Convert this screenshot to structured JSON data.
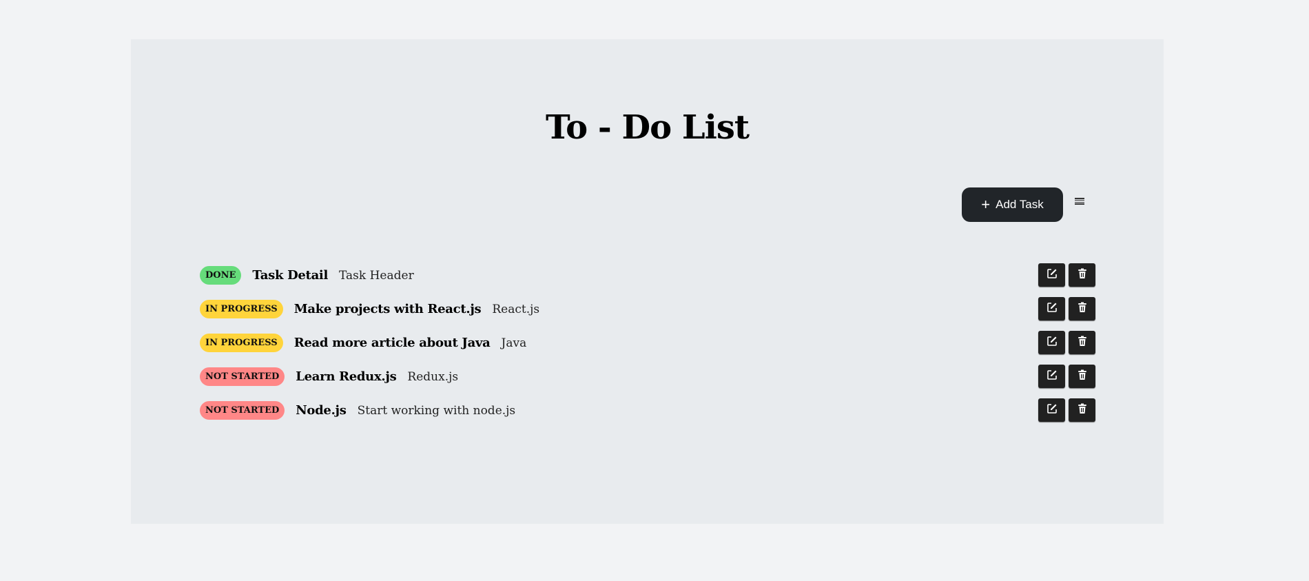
{
  "header": {
    "title": "To - Do List"
  },
  "toolbar": {
    "add_label": "Add Task",
    "add_icon": "plus-icon",
    "menu_icon": "list-icon"
  },
  "colors": {
    "done": "#66dc7b",
    "in_progress": "#ffd43b",
    "not_started": "#ff8787",
    "button": "#212529"
  },
  "tasks": [
    {
      "status": "DONE",
      "title": "Task Detail",
      "description": "Task Header"
    },
    {
      "status": "IN PROGRESS",
      "title": "Make projects with React.js",
      "description": "React.js"
    },
    {
      "status": "IN PROGRESS",
      "title": "Read more article about Java",
      "description": "Java"
    },
    {
      "status": "NOT STARTED",
      "title": "Learn Redux.js",
      "description": "Redux.js"
    },
    {
      "status": "NOT STARTED",
      "title": "Node.js",
      "description": "Start working with node.js"
    }
  ]
}
